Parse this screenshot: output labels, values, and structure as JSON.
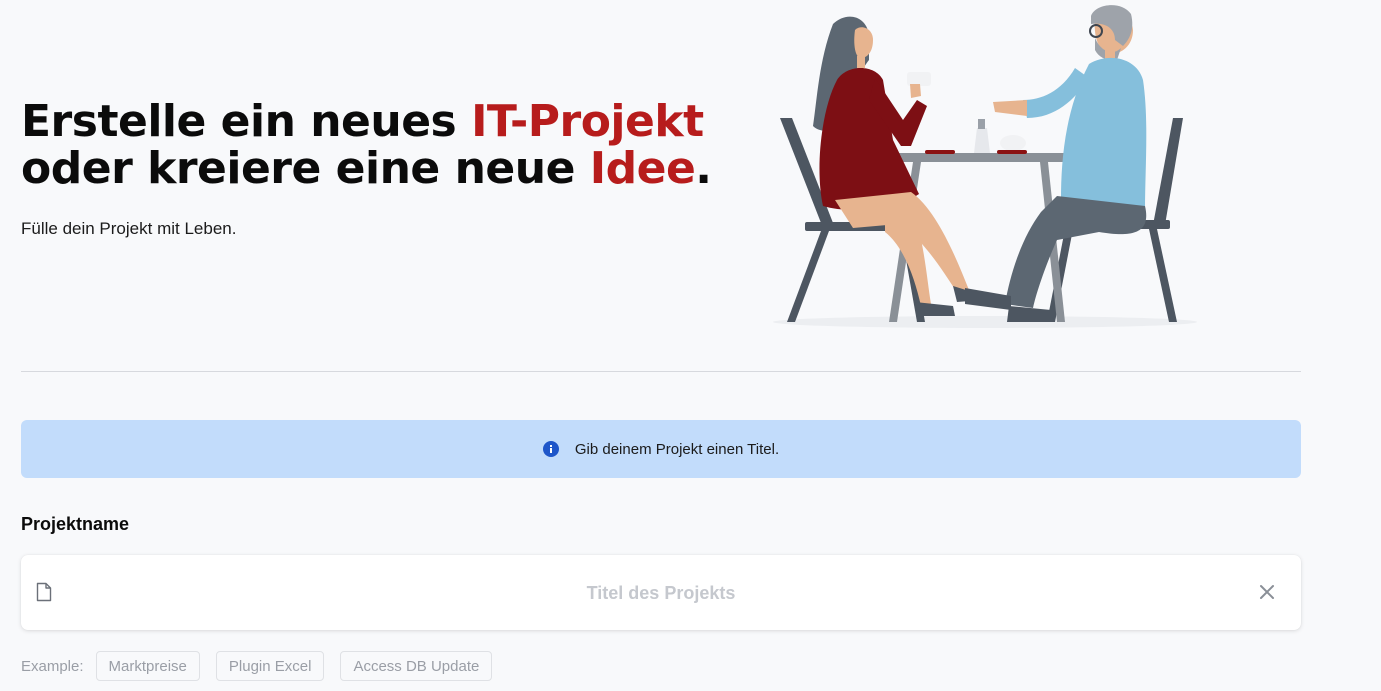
{
  "hero": {
    "title_part1": "Erstelle ein neues ",
    "title_accent1": "IT-Projekt",
    "title_part2": "oder kreiere eine neue ",
    "title_accent2": "Idee",
    "title_end": ".",
    "subtitle": "Fülle dein Projekt mit Leben.",
    "accent_color": "#b71c1c",
    "illustration": "two-people-at-cafe-table-illustration"
  },
  "info_banner": {
    "icon": "info-icon",
    "text": "Gib deinem Projekt einen Titel.",
    "background": "#c2dcfb"
  },
  "project_field": {
    "label": "Projektname",
    "icon": "document-icon",
    "value": "",
    "placeholder": "Titel des Projekts",
    "clear_icon": "close-icon"
  },
  "examples": {
    "label": "Example:",
    "items": [
      "Marktpreise",
      "Plugin Excel",
      "Access DB Update"
    ]
  }
}
